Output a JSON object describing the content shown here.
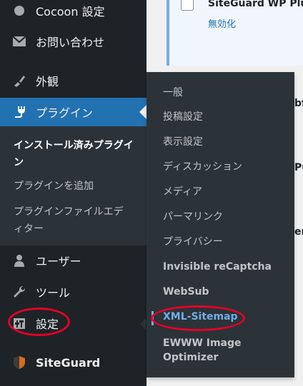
{
  "sidebar": {
    "items": [
      {
        "key": "cocoon",
        "label": "Cocoon 設定",
        "icon": "cocoon-circle-icon"
      },
      {
        "key": "contact",
        "label": "お問い合わせ",
        "icon": "mail-icon"
      },
      {
        "key": "appearance",
        "label": "外観",
        "icon": "paintbrush-icon"
      },
      {
        "key": "plugins",
        "label": "プラグイン",
        "icon": "plugin-plug-icon"
      },
      {
        "key": "users",
        "label": "ユーザー",
        "icon": "user-icon"
      },
      {
        "key": "tools",
        "label": "ツール",
        "icon": "wrench-icon"
      },
      {
        "key": "settings",
        "label": "設定",
        "icon": "settings-sliders-icon"
      },
      {
        "key": "siteguard",
        "label": "SiteGuard",
        "icon": "siteguard-shield-icon"
      }
    ],
    "plugins_submenu": [
      {
        "label": "インストール済みプラグイン"
      },
      {
        "label": "プラグインを追加"
      },
      {
        "label": "プラグインファイルエディター"
      }
    ]
  },
  "flyout": {
    "items": [
      {
        "label": "一般"
      },
      {
        "label": "投稿設定"
      },
      {
        "label": "表示設定"
      },
      {
        "label": "ディスカッション"
      },
      {
        "label": "メディア"
      },
      {
        "label": "パーマリンク"
      },
      {
        "label": "プライバシー"
      },
      {
        "label": "Invisible reCaptcha"
      },
      {
        "label": "WebSub"
      },
      {
        "label": "XML-Sitemap"
      },
      {
        "label": "EWWW Image Optimizer"
      }
    ]
  },
  "content": {
    "plugin_name": "SiteGuard WP Plu",
    "plugin_action": "無効化",
    "frag_1": "bf",
    "frag_2": "Pu",
    "frag_3": "er"
  },
  "colors": {
    "sidebar_bg": "#1d2327",
    "submenu_bg": "#2c3338",
    "current_bg": "#2271b1",
    "link_blue": "#72aee6",
    "annotation_red": "#e5002a"
  }
}
